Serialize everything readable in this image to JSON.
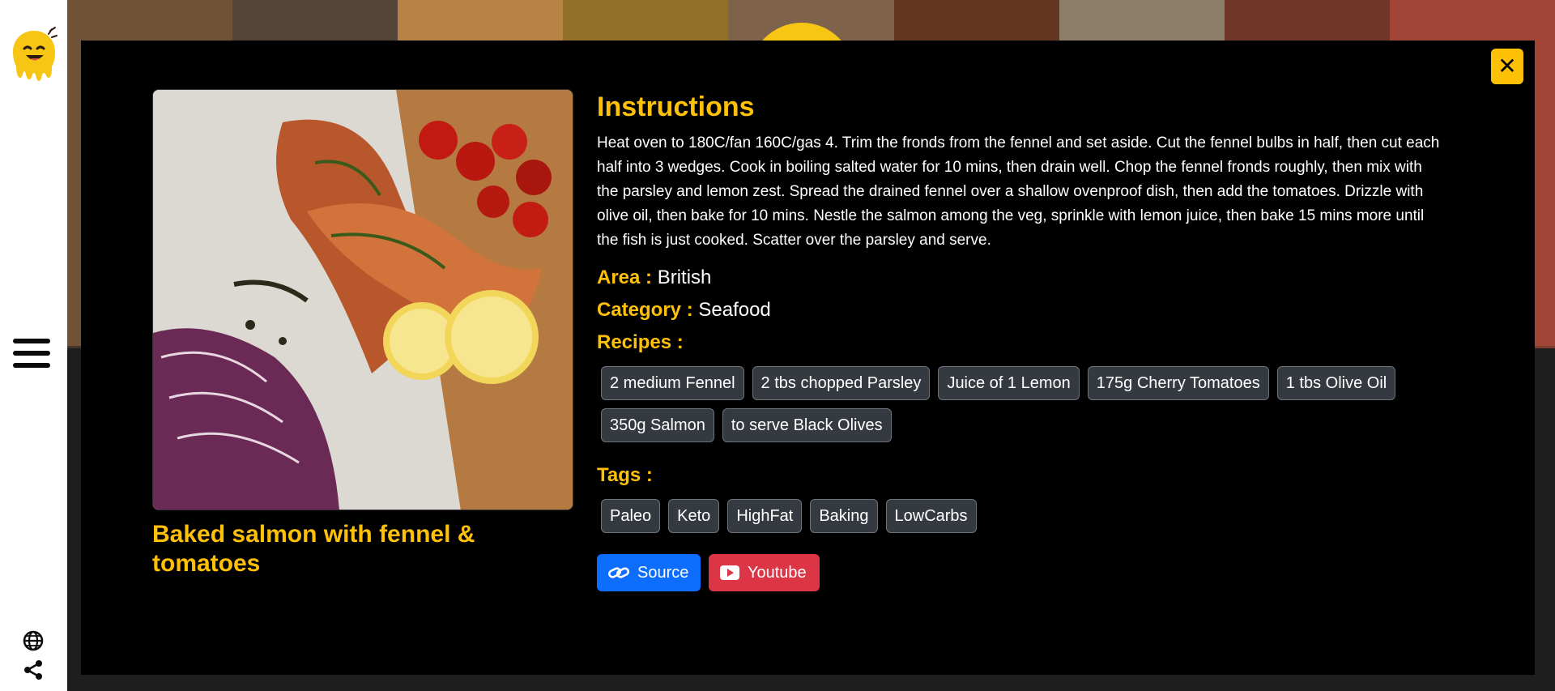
{
  "meal": {
    "title": "Baked salmon with fennel & tomatoes",
    "image_alt": "Baked salmon with fennel & tomatoes photo"
  },
  "instructions": {
    "heading": "Instructions",
    "text": "Heat oven to 180C/fan 160C/gas 4. Trim the fronds from the fennel and set aside. Cut the fennel bulbs in half, then cut each half into 3 wedges. Cook in boiling salted water for 10 mins, then drain well. Chop the fennel fronds roughly, then mix with the parsley and lemon zest. Spread the drained fennel over a shallow ovenproof dish, then add the tomatoes. Drizzle with olive oil, then bake for 10 mins. Nestle the salmon among the veg, sprinkle with lemon juice, then bake 15 mins more until the fish is just cooked. Scatter over the parsley and serve."
  },
  "area": {
    "label": "Area :",
    "value": "British"
  },
  "category": {
    "label": "Category :",
    "value": "Seafood"
  },
  "recipes": {
    "label": "Recipes :",
    "items": [
      "2 medium Fennel",
      "2 tbs chopped Parsley",
      "Juice of 1 Lemon",
      "175g Cherry Tomatoes",
      "1 tbs Olive Oil",
      "350g Salmon",
      "to serve Black Olives"
    ]
  },
  "tags": {
    "label": "Tags :",
    "items": [
      "Paleo",
      "Keto",
      "HighFat",
      "Baking",
      "LowCarbs"
    ]
  },
  "links": {
    "source_label": "Source",
    "youtube_label": "Youtube"
  },
  "colors": {
    "accent": "#ffc107",
    "source_button": "#0d6efd",
    "youtube_button": "#dc3545",
    "badge_bg": "#343a40"
  },
  "icons": {
    "close": "close-icon",
    "menu": "hamburger-menu-icon",
    "globe": "globe-icon",
    "share": "share-icon",
    "link": "link-icon",
    "youtube": "youtube-icon"
  }
}
